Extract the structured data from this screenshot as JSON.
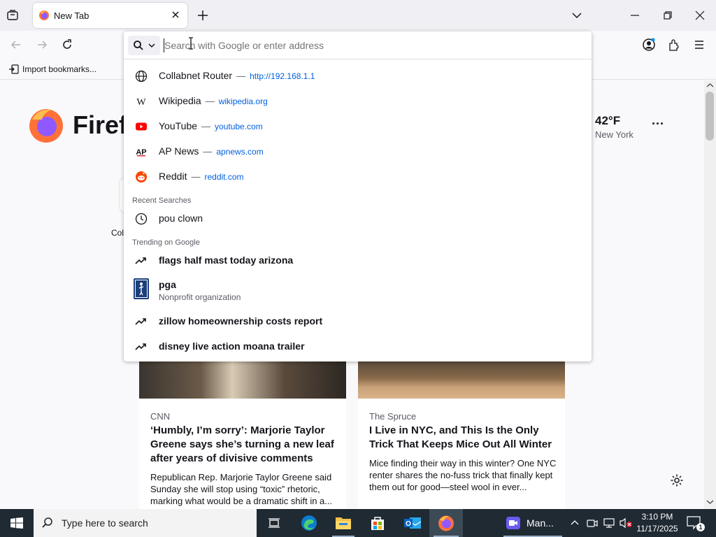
{
  "browser": {
    "tab_title": "New Tab",
    "import_bookmarks": "Import bookmarks...",
    "address_placeholder": "Search with Google or enter address"
  },
  "suggestions": {
    "shortcuts": [
      {
        "name": "Collabnet Router",
        "url": "http://192.168.1.1",
        "icon": "globe-icon"
      },
      {
        "name": "Wikipedia",
        "url": "wikipedia.org",
        "icon": "wikipedia-icon"
      },
      {
        "name": "YouTube",
        "url": "youtube.com",
        "icon": "youtube-icon"
      },
      {
        "name": "AP News",
        "url": "apnews.com",
        "icon": "apnews-icon"
      },
      {
        "name": "Reddit",
        "url": "reddit.com",
        "icon": "reddit-icon"
      }
    ],
    "recent_label": "Recent Searches",
    "recent": [
      {
        "text": "pou clown",
        "icon": "history-clock-icon"
      }
    ],
    "trending_label": "Trending on Google",
    "trending": [
      {
        "text": "flags half mast today arizona",
        "icon": "trending-icon"
      },
      {
        "text": "pga",
        "sub": "Nonprofit organization",
        "icon": "pga-logo-icon"
      },
      {
        "text": "zillow homeownership costs report",
        "icon": "trending-icon"
      },
      {
        "text": "disney live action moana trailer",
        "icon": "trending-icon"
      }
    ]
  },
  "newtab": {
    "logo_text": "Firef",
    "shortcut_partial": "Col",
    "weather": {
      "temp": "42°F",
      "city": "New York",
      "more": "···"
    },
    "stories": [
      {
        "source": "CNN",
        "headline": "‘Humbly, I’m sorry’: Marjorie Taylor Greene says she’s turning a new leaf after years of divisive comments",
        "desc": "Republican Rep. Marjorie Taylor Greene said Sunday she will stop using “toxic” rhetoric, marking what would be a dramatic shift in a..."
      },
      {
        "source": "The Spruce",
        "headline": "I Live in NYC, and This Is the Only Trick That Keeps Mice Out All Winter",
        "desc": "Mice finding their way in this winter? One NYC renter shares the no-fuss trick that finally kept them out for good—steel wool in ever..."
      }
    ]
  },
  "taskbar": {
    "search_placeholder": "Type here to search",
    "running_app": "Man...",
    "time": "3:10 PM",
    "date": "11/17/2025",
    "notification_count": "1"
  },
  "colors": {
    "accent": "#0060df",
    "taskbar": "#1f2a33",
    "firefox_orange": "#ff7139"
  }
}
